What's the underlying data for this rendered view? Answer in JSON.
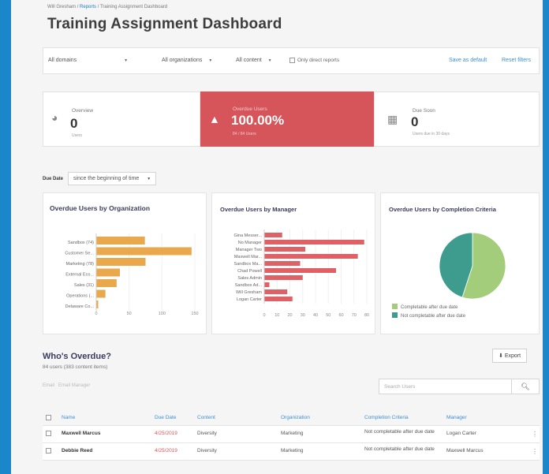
{
  "breadcrumb": {
    "user": "Will Gresham",
    "sep": "/",
    "reports": "Reports",
    "current": "Training Assignment Dashboard"
  },
  "title": "Training Assignment Dashboard",
  "filters": {
    "domains": "All domains",
    "organizations": "All organizations",
    "content": "All content",
    "direct_reports": "Only direct reports",
    "save_default": "Save as default",
    "reset": "Reset filters"
  },
  "stats": {
    "overview": {
      "label": "Overview",
      "value": "0",
      "sub": "Users"
    },
    "overdue": {
      "label": "Overdue Users",
      "value": "100.00%",
      "sub": "84 / 84 Users"
    },
    "due_soon": {
      "label": "Due Soon",
      "value": "0",
      "sub": "Users due in 30 days"
    }
  },
  "due_date": {
    "label": "Due Date",
    "value": "since the beginning of time"
  },
  "colors": {
    "orange": "#e9a84c",
    "red": "#e06165",
    "green": "#a3cd7a",
    "teal": "#3d9c8e",
    "blue": "#3b8fd0"
  },
  "chart_data": [
    {
      "type": "bar",
      "orientation": "horizontal",
      "title": "Overdue Users by Organization",
      "categories": [
        "Sandbox (74)",
        "Customer Se...",
        "Marketing (78)",
        "External Eco...",
        "Sales (31)",
        "Operations (...",
        "Delaware Co..."
      ],
      "values": [
        74,
        145,
        75,
        36,
        31,
        14,
        3
      ],
      "xlim": [
        0,
        150
      ],
      "xticks": [
        "0",
        "50",
        "100",
        "150"
      ]
    },
    {
      "type": "bar",
      "orientation": "horizontal",
      "title": "Overdue Users by Manager",
      "categories": [
        "Gina Messer...",
        "No Manager",
        "Manager Two",
        "Maxwell Mar...",
        "Sandbox Ma...",
        "Chad Powell",
        "Sales Admin",
        "Sandbox Ad...",
        "Will Gresham",
        "Logan Carter"
      ],
      "values": [
        14,
        78,
        32,
        73,
        28,
        56,
        30,
        4,
        18,
        22
      ],
      "xlim": [
        0,
        80
      ],
      "xticks": [
        "0",
        "10",
        "20",
        "30",
        "40",
        "50",
        "60",
        "70",
        "80"
      ]
    },
    {
      "type": "pie",
      "title": "Overdue Users by Completion Criteria",
      "series": [
        {
          "name": "Completable after due date",
          "value": 55
        },
        {
          "name": "Not completable after due date",
          "value": 45
        }
      ]
    }
  ],
  "whos_overdue": {
    "title": "Who's Overdue?",
    "sub": "84 users (383 content items)",
    "email": "Email",
    "email_manager": "Email Manager",
    "export": "Export",
    "search_placeholder": "Search Users",
    "columns": [
      "Name",
      "Due Date",
      "Content",
      "Organization",
      "Completion Criteria",
      "Manager"
    ],
    "rows": [
      [
        "Maxwell Marcus",
        "4/25/2019",
        "Diversity",
        "Marketing",
        "Not completable after due date",
        "Logan Carter"
      ],
      [
        "Debbie Reed",
        "4/25/2019",
        "Diversity",
        "Marketing",
        "Not completable after due date",
        "Maxwell Marcus"
      ]
    ]
  }
}
